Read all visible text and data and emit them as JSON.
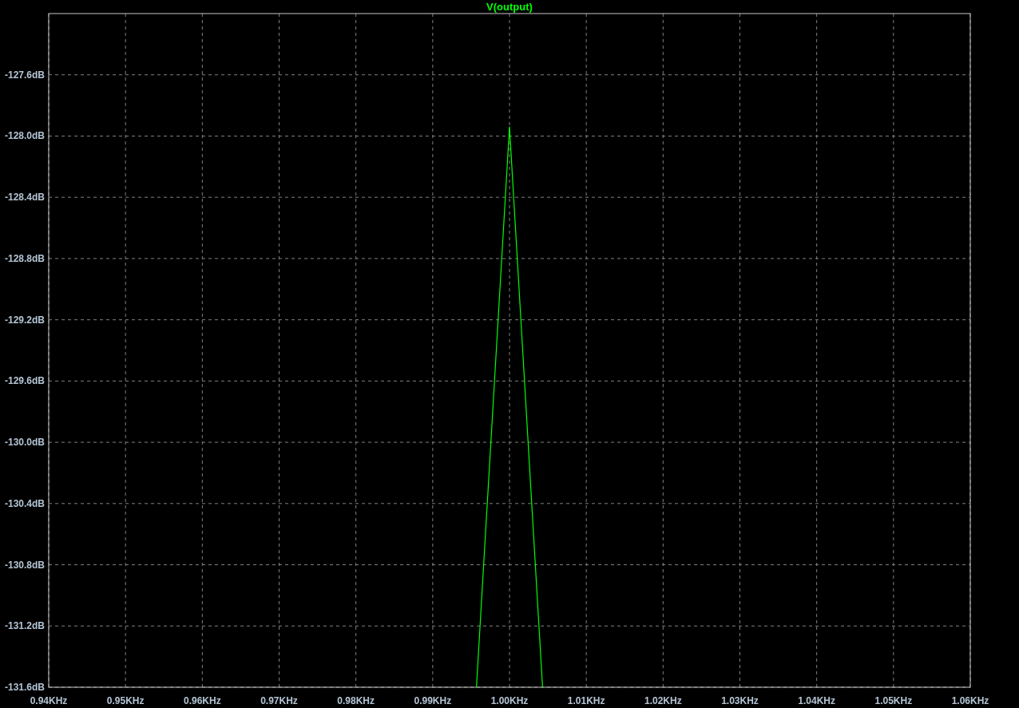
{
  "plot": {
    "chart_data": {
      "type": "line",
      "grid": true,
      "x": [
        0.9957,
        1.0,
        1.0043
      ],
      "series": [
        {
          "name": "V(output)",
          "color": "#00ff00",
          "values": [
            -131.6,
            -127.94,
            -131.6
          ]
        }
      ],
      "xlim": [
        0.94,
        1.06
      ],
      "ylim": [
        -131.6,
        -127.2
      ],
      "xticks": [
        {
          "value": 0.94,
          "label": "0.94KHz"
        },
        {
          "value": 0.95,
          "label": "0.95KHz"
        },
        {
          "value": 0.96,
          "label": "0.96KHz"
        },
        {
          "value": 0.97,
          "label": "0.97KHz"
        },
        {
          "value": 0.98,
          "label": "0.98KHz"
        },
        {
          "value": 0.99,
          "label": "0.99KHz"
        },
        {
          "value": 1.0,
          "label": "1.00KHz"
        },
        {
          "value": 1.01,
          "label": "1.01KHz"
        },
        {
          "value": 1.02,
          "label": "1.02KHz"
        },
        {
          "value": 1.03,
          "label": "1.03KHz"
        },
        {
          "value": 1.04,
          "label": "1.04KHz"
        },
        {
          "value": 1.05,
          "label": "1.05KHz"
        },
        {
          "value": 1.06,
          "label": "1.06KHz"
        }
      ],
      "yticks": [
        {
          "value": -127.6,
          "label": "-127.6dB"
        },
        {
          "value": -128.0,
          "label": "-128.0dB"
        },
        {
          "value": -128.4,
          "label": "-128.4dB"
        },
        {
          "value": -128.8,
          "label": "-128.8dB"
        },
        {
          "value": -129.2,
          "label": "-129.2dB"
        },
        {
          "value": -129.6,
          "label": "-129.6dB"
        },
        {
          "value": -130.0,
          "label": "-130.0dB"
        },
        {
          "value": -130.4,
          "label": "-130.4dB"
        },
        {
          "value": -130.8,
          "label": "-130.8dB"
        },
        {
          "value": -131.2,
          "label": "-131.2dB"
        },
        {
          "value": -131.6,
          "label": "-131.6dB"
        }
      ]
    }
  }
}
